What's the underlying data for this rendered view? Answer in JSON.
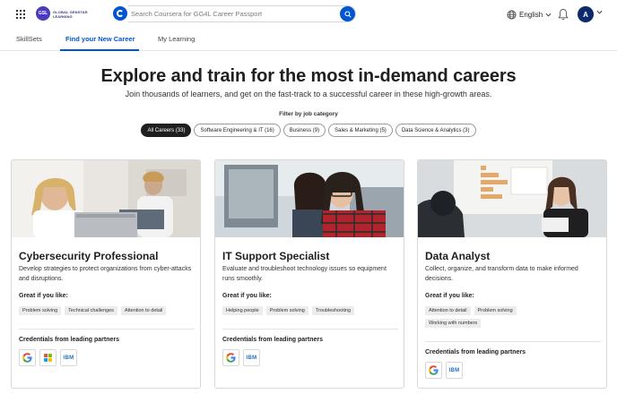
{
  "header": {
    "org_logo_text": "GSL",
    "org_name": "GLOBAL GENSTAR LEARNING",
    "search_placeholder": "Search Coursera for GG4L Career Passport",
    "language": "English",
    "avatar_initial": "A"
  },
  "nav": {
    "tabs": [
      {
        "label": "SkillSets",
        "active": false
      },
      {
        "label": "Find your New Career",
        "active": true
      },
      {
        "label": "My Learning",
        "active": false
      }
    ]
  },
  "hero": {
    "title": "Explore and train for the most in-demand careers",
    "subtitle": "Join thousands of learners, and get on the fast-track to a successful career in these high-growth areas."
  },
  "filter": {
    "label": "Filter by job category",
    "chips": [
      {
        "label": "All Careers (33)",
        "active": true
      },
      {
        "label": "Software Engineering & IT (16)",
        "active": false
      },
      {
        "label": "Business (9)",
        "active": false
      },
      {
        "label": "Sales & Marketing (5)",
        "active": false
      },
      {
        "label": "Data Science & Analytics (3)",
        "active": false
      }
    ]
  },
  "cards": [
    {
      "title": "Cybersecurity Professional",
      "description": "Develop strategies to protect organizations from cyber-attacks and disruptions.",
      "great_label": "Great if you like:",
      "tags": [
        "Problem solving",
        "Technical challenges",
        "Attention to detail"
      ],
      "cred_label": "Credentials from leading partners",
      "partners": [
        "google-logo",
        "microsoft-logo",
        "ibm-logo"
      ]
    },
    {
      "title": "IT Support Specialist",
      "description": "Evaluate and troubleshoot technology issues so equipment runs smoothly.",
      "great_label": "Great if you like:",
      "tags": [
        "Helping people",
        "Problem solving",
        "Troubleshooting"
      ],
      "cred_label": "Credentials from leading partners",
      "partners": [
        "google-logo",
        "ibm-logo"
      ]
    },
    {
      "title": "Data Analyst",
      "description": "Collect, organize, and transform data to make informed decisions.",
      "great_label": "Great if you like:",
      "tags": [
        "Attention to detail",
        "Problem solving",
        "Working with numbers"
      ],
      "cred_label": "Credentials from leading partners",
      "partners": [
        "google-logo",
        "ibm-logo"
      ]
    }
  ],
  "logo_text": {
    "ibm": "IBM"
  },
  "colors": {
    "brand_blue": "#0056d2",
    "active_chip": "#1f1f1f",
    "avatar": "#0e2a6b"
  }
}
